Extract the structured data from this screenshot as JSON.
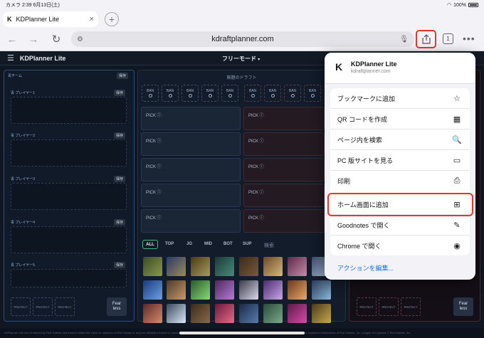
{
  "status_bar": {
    "left": "カメラ  2:39  6月13日(土)",
    "battery": "100%"
  },
  "browser": {
    "tab_title": "KDPlanner Lite",
    "url": "kdraftplanner.com",
    "tab_count": "1"
  },
  "app": {
    "brand": "KDPlanner Lite",
    "mode": "フリーモード",
    "draft_title": "無題のドラフト",
    "blue_team": {
      "header": "青チーム",
      "save": "保存",
      "players": [
        "青 プレイヤー1",
        "青 プレイヤー2",
        "青 プレイヤー3",
        "青 プレイヤー4",
        "青 プレイヤー5"
      ],
      "protect": "PROTECT",
      "fearless": "Fear\nless"
    },
    "ban_label": "BAN",
    "pick_label": "PICK",
    "filters": [
      "ALL",
      "TOP",
      "JG",
      "MID",
      "BOT",
      "SUP"
    ],
    "search_placeholder": "検索",
    "footer": "KDPlanner Lite isn't endorsed by Riot Games and doesn't reflect the views or opinions of Riot Games or anyone officially involved in producing or managing Riot Games properties. Riot Games, and all associated properties are trademarks or registered trademarks of Riot Games, Inc. League of Legends © Riot Games, Inc."
  },
  "share_sheet": {
    "site_title": "KDPlanner Lite",
    "site_url": "kdraftplanner.com",
    "items": [
      {
        "label": "ブックマークに追加",
        "icon": "star-icon"
      },
      {
        "label": "QR コードを作成",
        "icon": "qr-icon"
      },
      {
        "label": "ページ内を検索",
        "icon": "find-icon"
      },
      {
        "label": "PC 版サイトを見る",
        "icon": "desktop-icon"
      },
      {
        "label": "印刷",
        "icon": "printer-icon"
      },
      {
        "label": "ホーム画面に追加",
        "icon": "add-square-icon"
      },
      {
        "label": "Goodnotes で開く",
        "icon": "goodnotes-icon"
      },
      {
        "label": "Chrome で開く",
        "icon": "chrome-icon"
      }
    ],
    "edit_actions": "アクションを編集..."
  },
  "colors": {
    "highlight": "#e0392b",
    "blue_border": "#2a4f78",
    "red_border": "#4a2a30",
    "link": "#1a73e8"
  }
}
